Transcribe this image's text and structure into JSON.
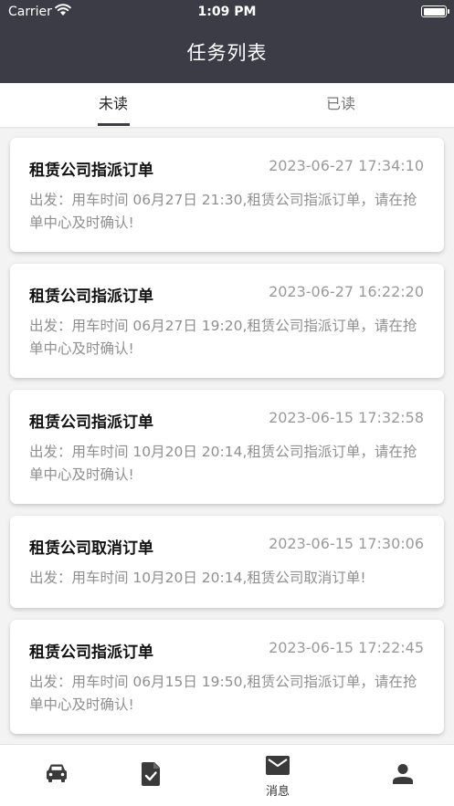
{
  "status_bar": {
    "carrier": "Carrier",
    "time": "1:09 PM"
  },
  "header": {
    "title": "任务列表"
  },
  "tabs": [
    {
      "label": "未读",
      "active": true
    },
    {
      "label": "已读",
      "active": false
    }
  ],
  "tasks": [
    {
      "title": "租赁公司指派订单",
      "time": "2023-06-27 17:34:10",
      "body": "出发：用车时间 06月27日 21:30,租赁公司指派订单，请在抢单中心及时确认!"
    },
    {
      "title": "租赁公司指派订单",
      "time": "2023-06-27 16:22:20",
      "body": "出发：用车时间 06月27日 19:20,租赁公司指派订单，请在抢单中心及时确认!"
    },
    {
      "title": "租赁公司指派订单",
      "time": "2023-06-15 17:32:58",
      "body": "出发：用车时间 10月20日 20:14,租赁公司指派订单，请在抢单中心及时确认!"
    },
    {
      "title": "租赁公司取消订单",
      "time": "2023-06-15 17:30:06",
      "body": "出发：用车时间 10月20日 20:14,租赁公司取消订单!"
    },
    {
      "title": "租赁公司指派订单",
      "time": "2023-06-15 17:22:45",
      "body": "出发：用车时间 06月15日 19:50,租赁公司指派订单，请在抢单中心及时确认!"
    }
  ],
  "bottom_nav": [
    {
      "icon": "car-icon",
      "label": ""
    },
    {
      "icon": "task-icon",
      "label": ""
    },
    {
      "icon": "mail-icon",
      "label": "消息",
      "active": true
    },
    {
      "icon": "person-icon",
      "label": ""
    }
  ],
  "colors": {
    "header_bg": "#3c3c46",
    "accent": "#3c3c46",
    "muted_text": "#8f8f8f"
  }
}
